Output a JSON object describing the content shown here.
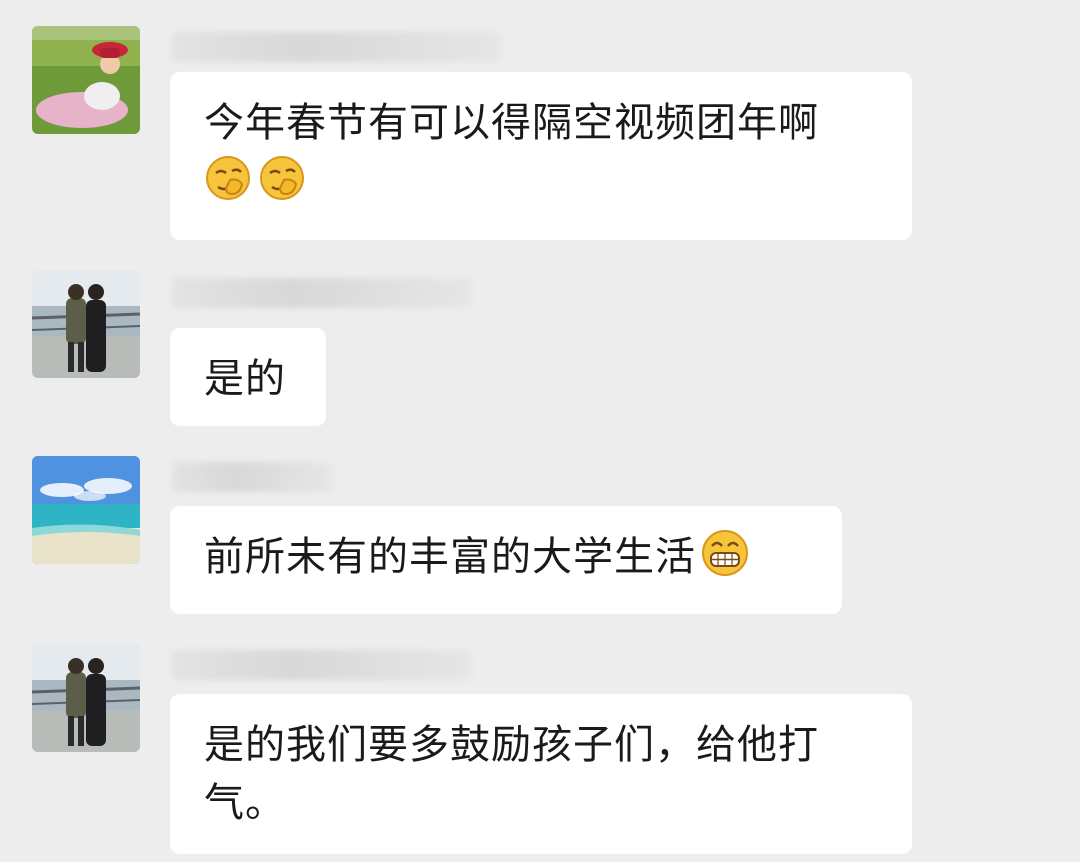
{
  "messages": [
    {
      "avatar_icon": "woman-on-grass-avatar",
      "text": "今年春节有可以得隔空视频团年啊",
      "emojis": [
        "covering-mouth-emoji",
        "covering-mouth-emoji"
      ]
    },
    {
      "avatar_icon": "couple-by-railing-avatar",
      "text": "是的"
    },
    {
      "avatar_icon": "sea-and-sky-avatar",
      "text": "前所未有的丰富的大学生活",
      "emojis": [
        "grinning-emoji"
      ]
    },
    {
      "avatar_icon": "couple-by-railing-avatar",
      "text": "是的我们要多鼓励孩子们，给他打气。"
    }
  ]
}
